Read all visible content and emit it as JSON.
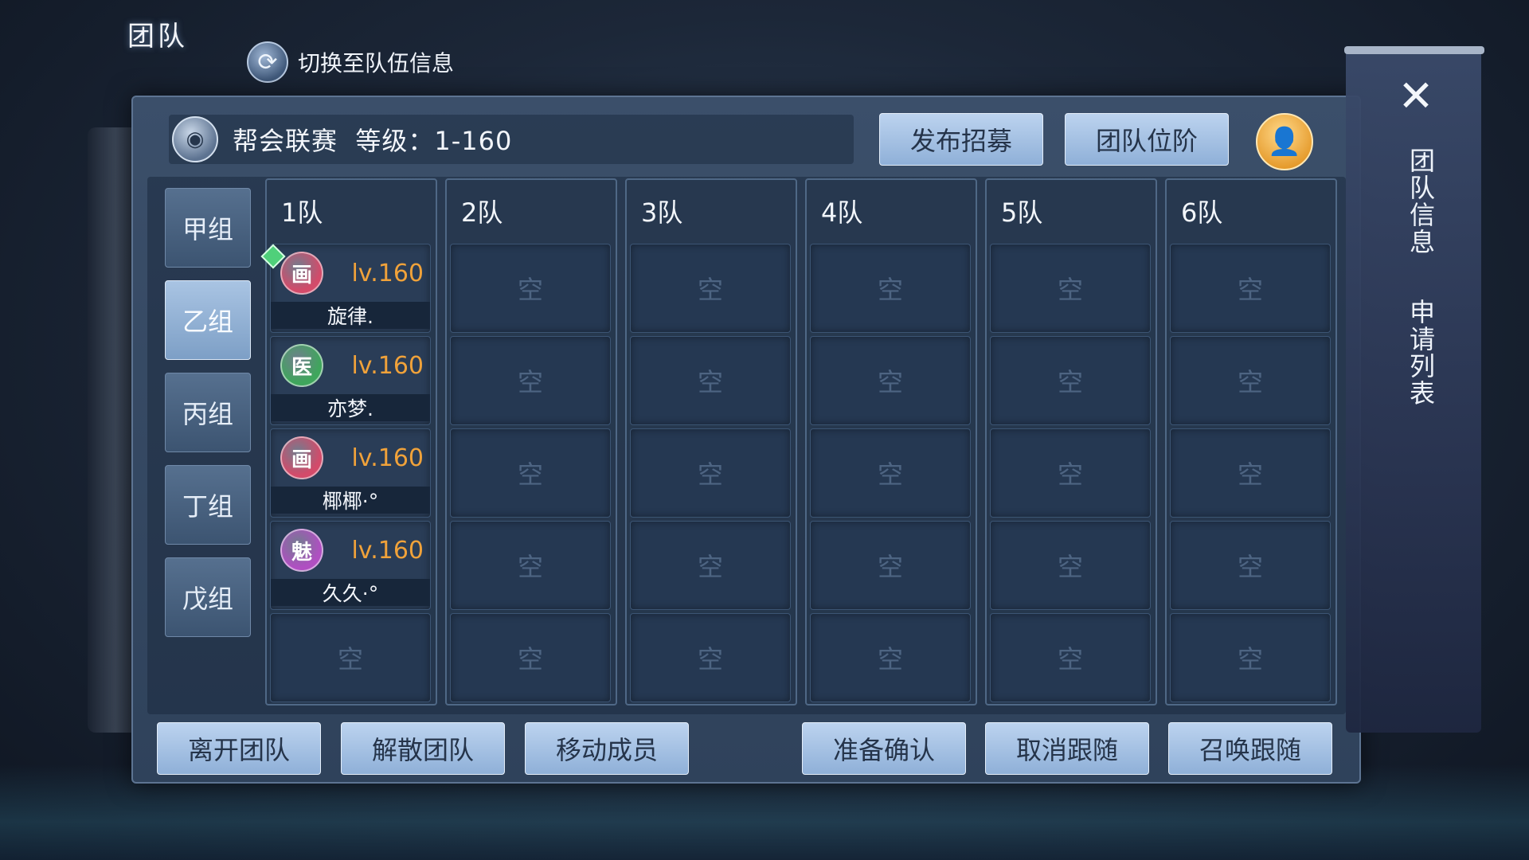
{
  "header": {
    "title": "团队",
    "switch_label": "切换至队伍信息"
  },
  "info": {
    "text": "帮会联赛  等级：1-160"
  },
  "top_buttons": {
    "recruit": "发布招募",
    "rank": "团队位阶"
  },
  "groups": [
    "甲组",
    "乙组",
    "丙组",
    "丁组",
    "戊组"
  ],
  "active_group": "乙组",
  "teams": [
    "1队",
    "2队",
    "3队",
    "4队",
    "5队",
    "6队"
  ],
  "empty_label": "空",
  "members": [
    {
      "name": "旋律.",
      "level": "lv.160",
      "icon": "画",
      "color": "#d34b6a",
      "leader": true
    },
    {
      "name": "亦梦.",
      "level": "lv.160",
      "icon": "医",
      "color": "#3fa65c",
      "leader": false
    },
    {
      "name": "椰椰·°",
      "level": "lv.160",
      "icon": "画",
      "color": "#d34b6a",
      "leader": false
    },
    {
      "name": "久久·°",
      "level": "lv.160",
      "icon": "魅",
      "color": "#b04fc2",
      "leader": false
    }
  ],
  "bottom_buttons": {
    "leave": "离开团队",
    "disband": "解散团队",
    "move": "移动成员",
    "ready": "准备确认",
    "cancel_follow": "取消跟随",
    "summon_follow": "召唤跟随"
  },
  "side_tabs": {
    "team_info": "团队信息",
    "apply_list": "申请列表",
    "close": "✕"
  }
}
